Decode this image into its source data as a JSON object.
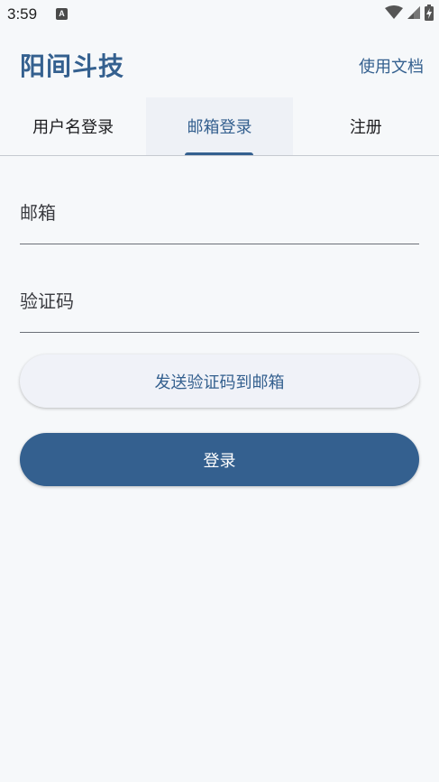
{
  "status_bar": {
    "time": "3:59",
    "notification_letter": "A",
    "icons": [
      "wifi-icon",
      "signal-icon",
      "battery-charging-icon"
    ]
  },
  "header": {
    "title": "阳间斗技",
    "docs_link": "使用文档"
  },
  "tabs": [
    {
      "label": "用户名登录",
      "active": false
    },
    {
      "label": "邮箱登录",
      "active": true
    },
    {
      "label": "注册",
      "active": false
    }
  ],
  "form": {
    "email_placeholder": "邮箱",
    "email_value": "",
    "code_placeholder": "验证码",
    "code_value": "",
    "send_code_label": "发送验证码到邮箱",
    "login_label": "登录"
  },
  "colors": {
    "accent": "#34608f",
    "background": "#f6f8fa",
    "active_tab_bg": "#eef1f6",
    "secondary_button_bg": "#f0f2f8"
  }
}
